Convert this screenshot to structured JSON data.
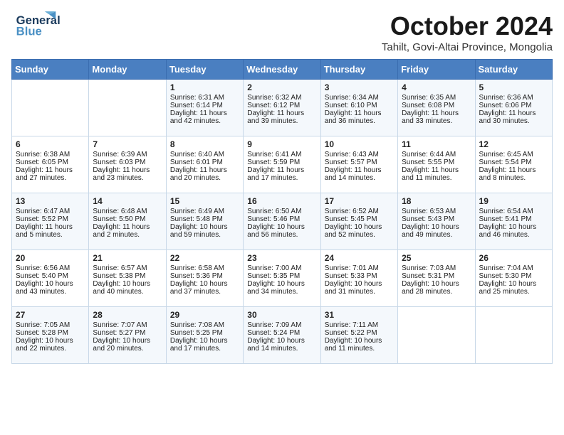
{
  "header": {
    "logo_line1": "General",
    "logo_line2": "Blue",
    "month": "October 2024",
    "location": "Tahilt, Govi-Altai Province, Mongolia"
  },
  "weekdays": [
    "Sunday",
    "Monday",
    "Tuesday",
    "Wednesday",
    "Thursday",
    "Friday",
    "Saturday"
  ],
  "weeks": [
    [
      {
        "day": "",
        "sunrise": "",
        "sunset": "",
        "daylight": ""
      },
      {
        "day": "",
        "sunrise": "",
        "sunset": "",
        "daylight": ""
      },
      {
        "day": "1",
        "sunrise": "Sunrise: 6:31 AM",
        "sunset": "Sunset: 6:14 PM",
        "daylight": "Daylight: 11 hours and 42 minutes."
      },
      {
        "day": "2",
        "sunrise": "Sunrise: 6:32 AM",
        "sunset": "Sunset: 6:12 PM",
        "daylight": "Daylight: 11 hours and 39 minutes."
      },
      {
        "day": "3",
        "sunrise": "Sunrise: 6:34 AM",
        "sunset": "Sunset: 6:10 PM",
        "daylight": "Daylight: 11 hours and 36 minutes."
      },
      {
        "day": "4",
        "sunrise": "Sunrise: 6:35 AM",
        "sunset": "Sunset: 6:08 PM",
        "daylight": "Daylight: 11 hours and 33 minutes."
      },
      {
        "day": "5",
        "sunrise": "Sunrise: 6:36 AM",
        "sunset": "Sunset: 6:06 PM",
        "daylight": "Daylight: 11 hours and 30 minutes."
      }
    ],
    [
      {
        "day": "6",
        "sunrise": "Sunrise: 6:38 AM",
        "sunset": "Sunset: 6:05 PM",
        "daylight": "Daylight: 11 hours and 27 minutes."
      },
      {
        "day": "7",
        "sunrise": "Sunrise: 6:39 AM",
        "sunset": "Sunset: 6:03 PM",
        "daylight": "Daylight: 11 hours and 23 minutes."
      },
      {
        "day": "8",
        "sunrise": "Sunrise: 6:40 AM",
        "sunset": "Sunset: 6:01 PM",
        "daylight": "Daylight: 11 hours and 20 minutes."
      },
      {
        "day": "9",
        "sunrise": "Sunrise: 6:41 AM",
        "sunset": "Sunset: 5:59 PM",
        "daylight": "Daylight: 11 hours and 17 minutes."
      },
      {
        "day": "10",
        "sunrise": "Sunrise: 6:43 AM",
        "sunset": "Sunset: 5:57 PM",
        "daylight": "Daylight: 11 hours and 14 minutes."
      },
      {
        "day": "11",
        "sunrise": "Sunrise: 6:44 AM",
        "sunset": "Sunset: 5:55 PM",
        "daylight": "Daylight: 11 hours and 11 minutes."
      },
      {
        "day": "12",
        "sunrise": "Sunrise: 6:45 AM",
        "sunset": "Sunset: 5:54 PM",
        "daylight": "Daylight: 11 hours and 8 minutes."
      }
    ],
    [
      {
        "day": "13",
        "sunrise": "Sunrise: 6:47 AM",
        "sunset": "Sunset: 5:52 PM",
        "daylight": "Daylight: 11 hours and 5 minutes."
      },
      {
        "day": "14",
        "sunrise": "Sunrise: 6:48 AM",
        "sunset": "Sunset: 5:50 PM",
        "daylight": "Daylight: 11 hours and 2 minutes."
      },
      {
        "day": "15",
        "sunrise": "Sunrise: 6:49 AM",
        "sunset": "Sunset: 5:48 PM",
        "daylight": "Daylight: 10 hours and 59 minutes."
      },
      {
        "day": "16",
        "sunrise": "Sunrise: 6:50 AM",
        "sunset": "Sunset: 5:46 PM",
        "daylight": "Daylight: 10 hours and 56 minutes."
      },
      {
        "day": "17",
        "sunrise": "Sunrise: 6:52 AM",
        "sunset": "Sunset: 5:45 PM",
        "daylight": "Daylight: 10 hours and 52 minutes."
      },
      {
        "day": "18",
        "sunrise": "Sunrise: 6:53 AM",
        "sunset": "Sunset: 5:43 PM",
        "daylight": "Daylight: 10 hours and 49 minutes."
      },
      {
        "day": "19",
        "sunrise": "Sunrise: 6:54 AM",
        "sunset": "Sunset: 5:41 PM",
        "daylight": "Daylight: 10 hours and 46 minutes."
      }
    ],
    [
      {
        "day": "20",
        "sunrise": "Sunrise: 6:56 AM",
        "sunset": "Sunset: 5:40 PM",
        "daylight": "Daylight: 10 hours and 43 minutes."
      },
      {
        "day": "21",
        "sunrise": "Sunrise: 6:57 AM",
        "sunset": "Sunset: 5:38 PM",
        "daylight": "Daylight: 10 hours and 40 minutes."
      },
      {
        "day": "22",
        "sunrise": "Sunrise: 6:58 AM",
        "sunset": "Sunset: 5:36 PM",
        "daylight": "Daylight: 10 hours and 37 minutes."
      },
      {
        "day": "23",
        "sunrise": "Sunrise: 7:00 AM",
        "sunset": "Sunset: 5:35 PM",
        "daylight": "Daylight: 10 hours and 34 minutes."
      },
      {
        "day": "24",
        "sunrise": "Sunrise: 7:01 AM",
        "sunset": "Sunset: 5:33 PM",
        "daylight": "Daylight: 10 hours and 31 minutes."
      },
      {
        "day": "25",
        "sunrise": "Sunrise: 7:03 AM",
        "sunset": "Sunset: 5:31 PM",
        "daylight": "Daylight: 10 hours and 28 minutes."
      },
      {
        "day": "26",
        "sunrise": "Sunrise: 7:04 AM",
        "sunset": "Sunset: 5:30 PM",
        "daylight": "Daylight: 10 hours and 25 minutes."
      }
    ],
    [
      {
        "day": "27",
        "sunrise": "Sunrise: 7:05 AM",
        "sunset": "Sunset: 5:28 PM",
        "daylight": "Daylight: 10 hours and 22 minutes."
      },
      {
        "day": "28",
        "sunrise": "Sunrise: 7:07 AM",
        "sunset": "Sunset: 5:27 PM",
        "daylight": "Daylight: 10 hours and 20 minutes."
      },
      {
        "day": "29",
        "sunrise": "Sunrise: 7:08 AM",
        "sunset": "Sunset: 5:25 PM",
        "daylight": "Daylight: 10 hours and 17 minutes."
      },
      {
        "day": "30",
        "sunrise": "Sunrise: 7:09 AM",
        "sunset": "Sunset: 5:24 PM",
        "daylight": "Daylight: 10 hours and 14 minutes."
      },
      {
        "day": "31",
        "sunrise": "Sunrise: 7:11 AM",
        "sunset": "Sunset: 5:22 PM",
        "daylight": "Daylight: 10 hours and 11 minutes."
      },
      {
        "day": "",
        "sunrise": "",
        "sunset": "",
        "daylight": ""
      },
      {
        "day": "",
        "sunrise": "",
        "sunset": "",
        "daylight": ""
      }
    ]
  ]
}
